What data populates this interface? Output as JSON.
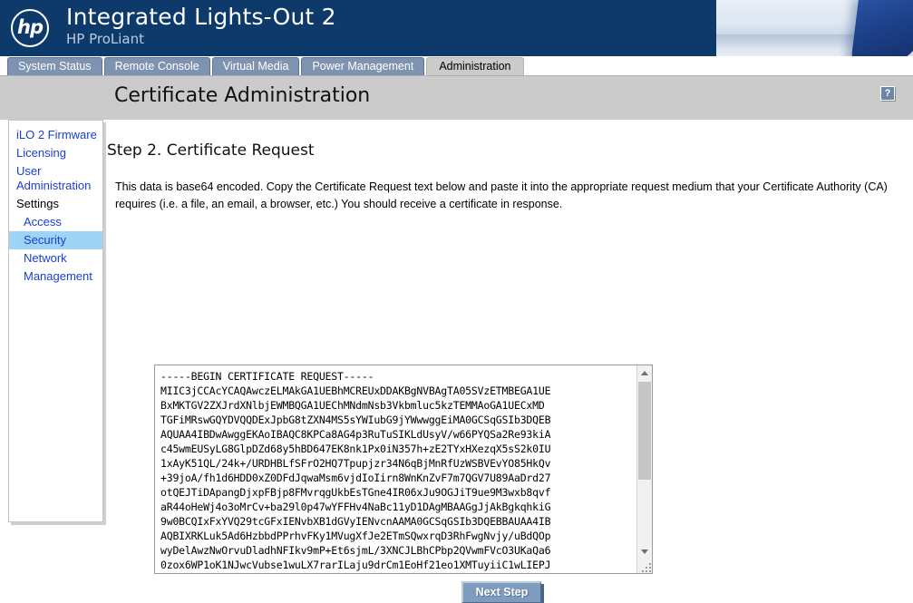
{
  "banner": {
    "logo_alt": "hp",
    "title": "Integrated Lights-Out 2",
    "subtitle": "HP ProLiant"
  },
  "tabs": [
    {
      "label": "System Status",
      "active": false
    },
    {
      "label": "Remote Console",
      "active": false
    },
    {
      "label": "Virtual Media",
      "active": false
    },
    {
      "label": "Power Management",
      "active": false
    },
    {
      "label": "Administration",
      "active": true
    }
  ],
  "header": {
    "page_title": "Certificate Administration",
    "help_label": "?"
  },
  "sidebar": {
    "items": [
      {
        "label": "iLO 2 Firmware",
        "type": "link",
        "selected": false
      },
      {
        "label": "Licensing",
        "type": "link",
        "selected": false
      },
      {
        "label": "User Administration",
        "type": "link",
        "selected": false
      },
      {
        "label": "Settings",
        "type": "header",
        "selected": false
      },
      {
        "label": "Access",
        "type": "sub",
        "selected": false
      },
      {
        "label": "Security",
        "type": "sub",
        "selected": true
      },
      {
        "label": "Network",
        "type": "sub",
        "selected": false
      },
      {
        "label": "Management",
        "type": "sub",
        "selected": false
      }
    ]
  },
  "main": {
    "step_heading": "Step 2. Certificate Request",
    "description": "This data is base64 encoded. Copy the Certificate Request text below and paste it into the appropriate request medium that your Certificate Authority (CA) requires (i.e. a file, an email, a browser, etc.) You should receive a certificate in response.",
    "certificate_text": "-----BEGIN CERTIFICATE REQUEST-----\nMIIC3jCCAcYCAQAwczELMAkGA1UEBhMCREUxDDAKBgNVBAgTA05SVzETMBEGA1UE\nBxMKTGV2ZXJrdXNlbjEWMBQGA1UEChMNdmNsb3Vkbmluc5kzTEMMAoGA1UECxMD\nTGFiMRswGQYDVQQDExJpbG8tZXN4MS5sYWIubG9jYWwwggEiMA0GCSqGSIb3DQEB\nAQUAA4IBDwAwggEKAoIBAQC8KPCa8AG4p3RuTuSIKLdUsyV/w66PYQSa2Re93kiA\nc45wmEUSyLG8GlpDZd68y5hBD647EK8nk1Px0iN357h+zE2TYxHXezqX5sS2k0IU\n1xAyK51QL/24k+/URDHBLfSFrO2HQ7Tpupjzr34N6qBjMnRfUzWSBVEvYO85HkQv\n+39joA/fh1d6HDD0xZ0DFdJqwaMsm6vjdIoIirn8WnKnZvF7m7QGV7U89AaDrd27\notQEJTiDApangDjxpFBjp8FMvrqgUkbEsTGne4IR06xJu9OGJiT9ue9M3wxb8qvf\naR44oHeWj4o3oMrCv+ba29l0p47wYFFHv4NaBc11yD1DAgMBAAGgJjAkBgkqhkiG\n9w0BCQIxFxYVQ29tcGFxIENvbXB1dGVyIENvcnAAMA0GCSqGSIb3DQEBBAUAA4IB\nAQBIXRKLuk5Ad6HzbbdPPrhvFKy1MVugXfJe2ETmSQwxrqD3RhFwgNvjy/uBdQOp\nwyDelAwzNwOrvuDladhNFIkv9mP+Et6sjmL/3XNCJLBhCPbp2QVwmFVcO3UKaQa6\n0zox6WP1oK1NJwcVubse1wuLX7rarILaju9drCm1EoHf21eo1XMTuyiiC1wLIEPJ",
    "next_button": "Next Step"
  }
}
